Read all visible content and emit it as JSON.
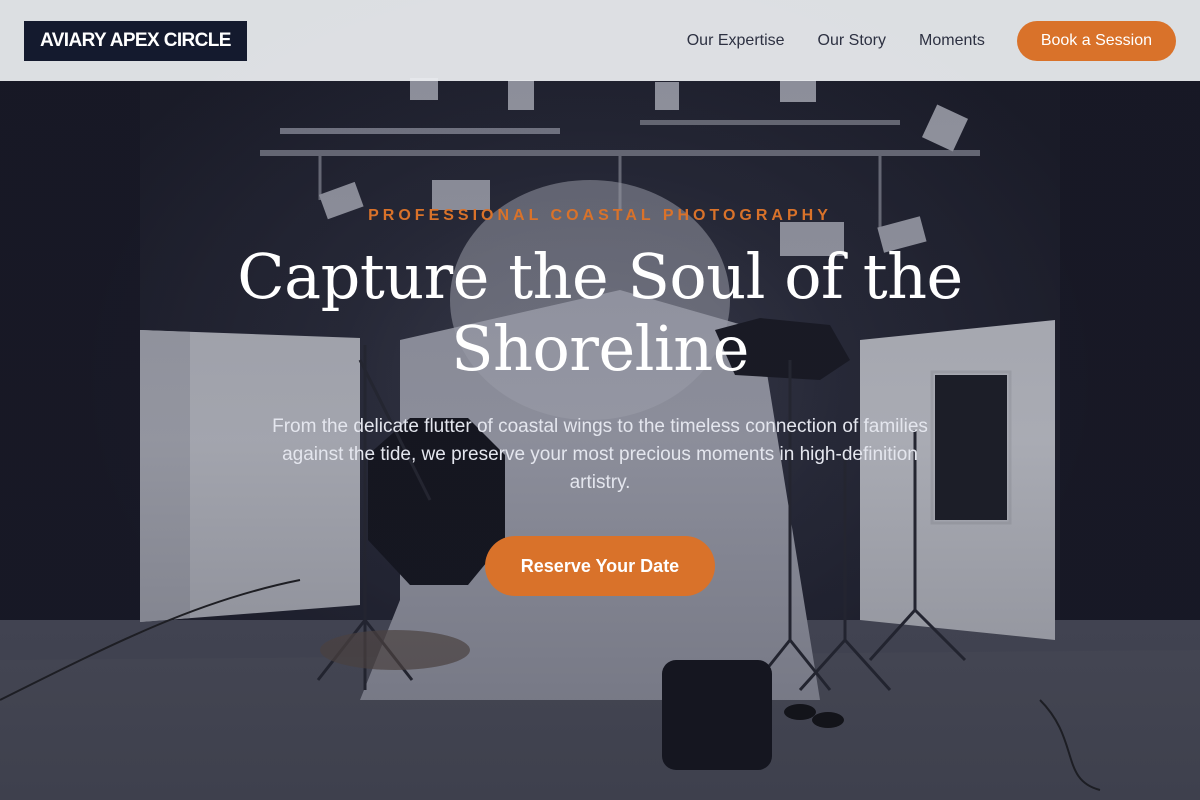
{
  "brand": {
    "name": "AVIARY APEX CIRCLE"
  },
  "nav": {
    "links": [
      "Our Expertise",
      "Our Story",
      "Moments"
    ],
    "cta_label": "Book a Session"
  },
  "hero": {
    "eyebrow": "PROFESSIONAL COASTAL PHOTOGRAPHY",
    "headline": "Capture the Soul of the Shoreline",
    "subtext": "From the delicate flutter of coastal wings to the timeless connection of families against the tide, we preserve your most precious moments in high-definition artistry.",
    "cta_label": "Reserve Your Date"
  },
  "colors": {
    "accent": "#d9722a",
    "logo_bg": "#141a2e",
    "header_bg": "#eceef1",
    "nav_text": "#2d3142"
  }
}
